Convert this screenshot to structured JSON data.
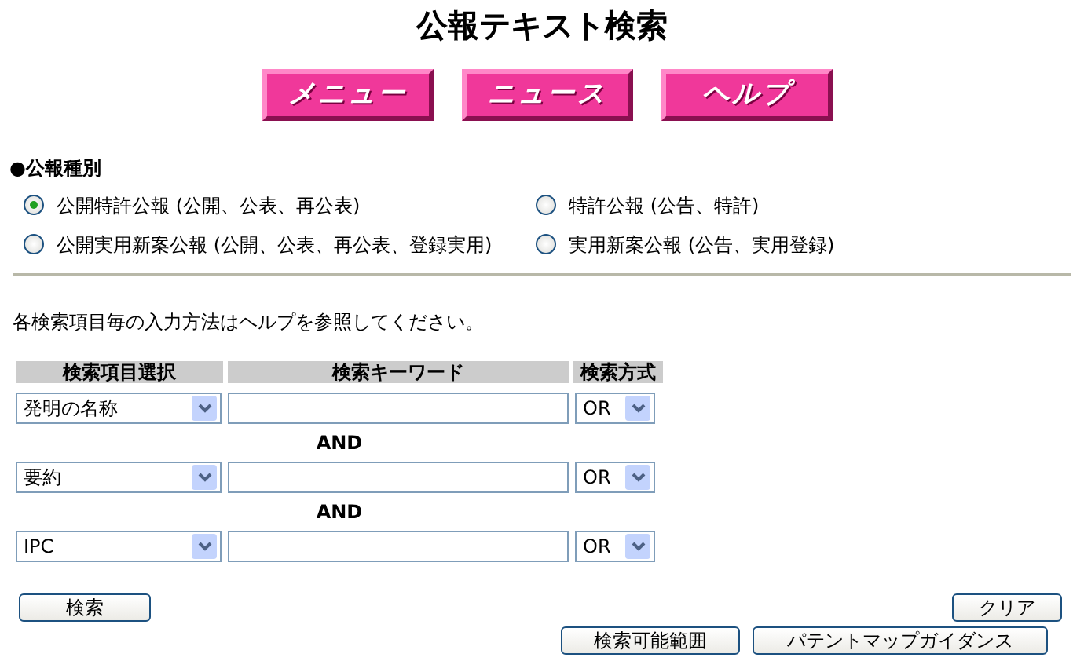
{
  "title": "公報テキスト検索",
  "nav_buttons": [
    "メニュー",
    "ニュース",
    "ヘルプ"
  ],
  "publication_type": {
    "heading": "●公報種別",
    "options": [
      {
        "label": "公開特許公報 (公開、公表、再公表)",
        "selected": true
      },
      {
        "label": "特許公報 (公告、特許)",
        "selected": false
      },
      {
        "label": "公開実用新案公報 (公開、公表、再公表、登録実用)",
        "selected": false
      },
      {
        "label": "実用新案公報 (公告、実用登録)",
        "selected": false
      }
    ]
  },
  "note": "各検索項目毎の入力方法はヘルプを参照してください。",
  "search_table": {
    "columns": [
      "検索項目選択",
      "検索キーワード",
      "検索方式"
    ],
    "rows": [
      {
        "field": "発明の名称",
        "method": "OR"
      },
      {
        "connector": "AND",
        "field": "要約",
        "method": "OR"
      },
      {
        "connector": "AND",
        "field": "IPC",
        "method": "OR"
      }
    ]
  },
  "buttons": {
    "search": "検索",
    "clear": "クリア",
    "scope": "検索可能範囲",
    "guidance": "パテントマップガイダンス"
  }
}
